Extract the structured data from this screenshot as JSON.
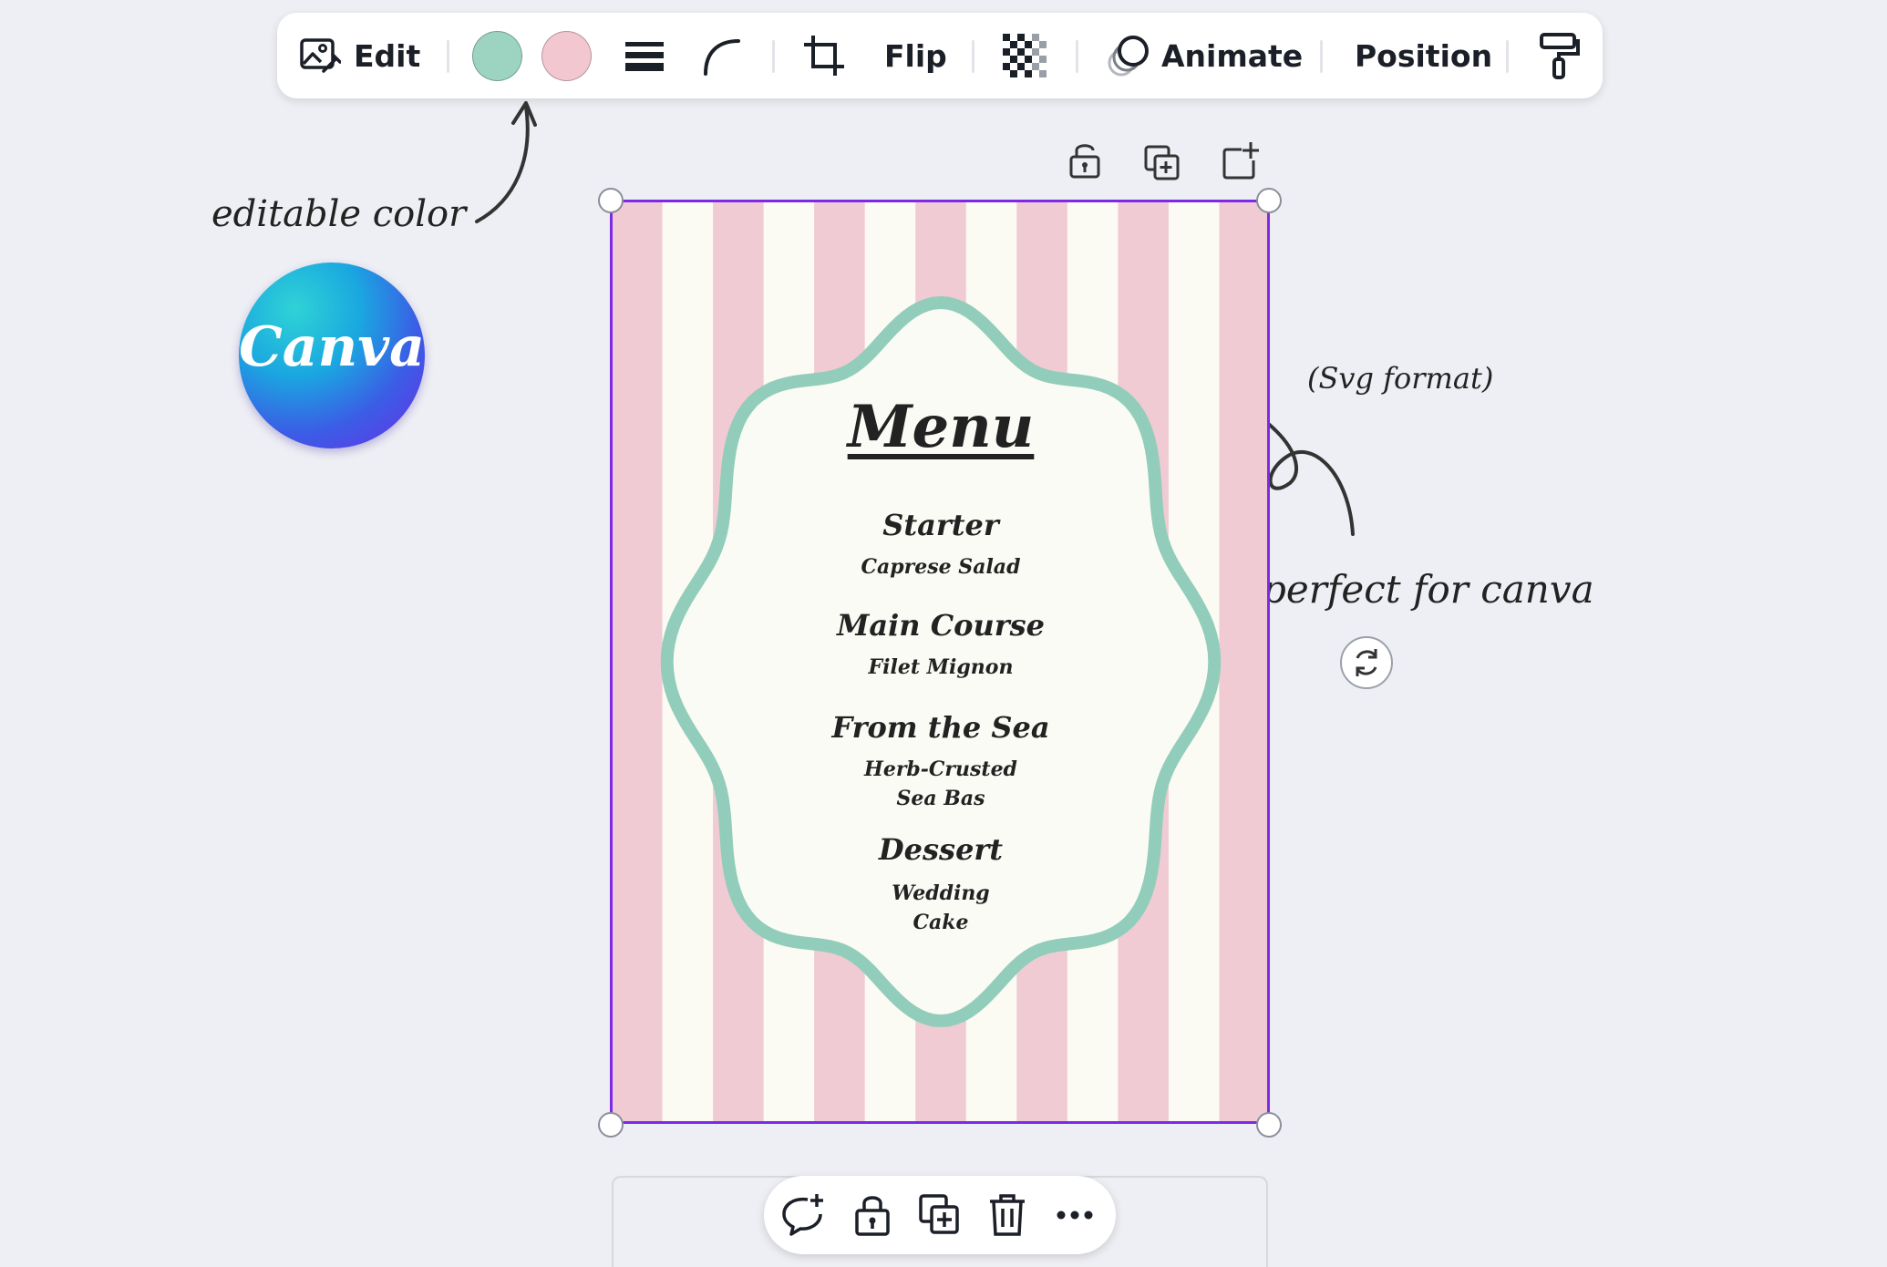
{
  "toolbar": {
    "edit_label": "Edit",
    "flip_label": "Flip",
    "animate_label": "Animate",
    "position_label": "Position",
    "colors": [
      "#9dd3c1",
      "#f2c7d0"
    ],
    "icons": [
      "edit-image-icon",
      "line-weight-icon",
      "corner-rounding-icon",
      "crop-icon",
      "transparency-icon",
      "animate-icon",
      "paint-roller-icon"
    ]
  },
  "annotations": {
    "editable_color": "editable color",
    "svg_format": "(Svg format)",
    "perfect_for_canva": "perfect for canva"
  },
  "logo": {
    "text": "Canva"
  },
  "design": {
    "stripe_colors": [
      "#f1cbd4",
      "#fbfaf3"
    ],
    "frame_color": "#92cdbb",
    "menu": {
      "title": "Menu",
      "sections": [
        {
          "heading": "Starter",
          "items": [
            "Caprese Salad"
          ]
        },
        {
          "heading": "Main Course",
          "items": [
            "Filet Mignon"
          ]
        },
        {
          "heading": "From the Sea",
          "items": [
            "Herb-Crusted",
            "Sea Bas"
          ]
        },
        {
          "heading": "Dessert",
          "items": [
            "Wedding",
            "Cake"
          ]
        }
      ]
    }
  },
  "canvas_actions": [
    "lock-icon",
    "duplicate-icon",
    "add-page-icon"
  ],
  "bottom_bar": [
    "add-comment-icon",
    "lock-icon",
    "duplicate-icon",
    "trash-icon",
    "more-icon"
  ],
  "accent_color": "#7d2ae8"
}
